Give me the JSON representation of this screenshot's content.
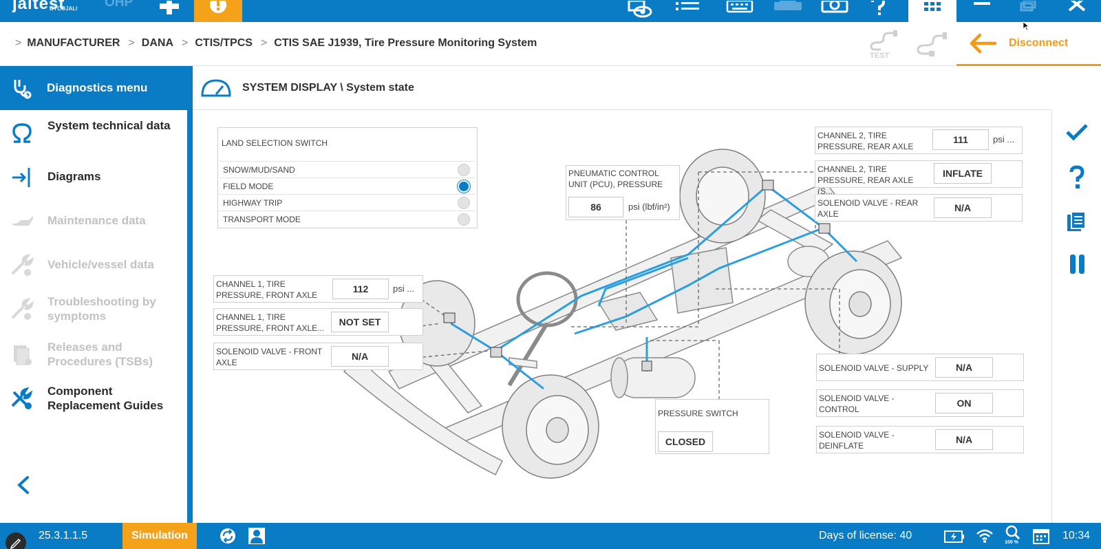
{
  "topbar": {
    "brand": "jaltest",
    "brand_sub": "BYCOJALI",
    "brand_suffix": "OHP",
    "icons": [
      "plus-icon",
      "alert-icon",
      "eye-icon",
      "list-icon",
      "keyboard-icon",
      "printer-icon",
      "camera-icon",
      "help-icon",
      "apps-grid-icon",
      "minimize-icon",
      "restore-icon",
      "close-icon"
    ],
    "accent": "#0a7cc6",
    "alert_color": "#f5a21b"
  },
  "breadcrumb": {
    "items": [
      "MANUFACTURER",
      "DANA",
      "CTIS/TPCS",
      "CTIS SAE J1939, Tire Pressure Monitoring System"
    ],
    "test_label": "TEST",
    "disconnect_label": "Disconnect"
  },
  "sidebar": {
    "header": "Diagnostics menu",
    "items": [
      {
        "label": "System technical data",
        "icon": "omega-icon",
        "enabled": true
      },
      {
        "label": "Diagrams",
        "icon": "diagram-icon",
        "enabled": true
      },
      {
        "label": "Maintenance data",
        "icon": "oil-can-icon",
        "enabled": false
      },
      {
        "label": "Vehicle/vessel data",
        "icon": "wrench-globe-icon",
        "enabled": false
      },
      {
        "label": "Troubleshooting by symptoms",
        "icon": "troubleshoot-icon",
        "enabled": false
      },
      {
        "label": "Releases and Procedures (TSBs)",
        "icon": "document-stack-icon",
        "enabled": false
      },
      {
        "label": "Component Replacement Guides",
        "icon": "tools-globe-icon",
        "enabled": true
      }
    ]
  },
  "main": {
    "title": "SYSTEM DISPLAY \\ System state",
    "land_selection": {
      "title": "LAND SELECTION SWITCH",
      "options": [
        {
          "label": "SNOW/MUD/SAND",
          "selected": false
        },
        {
          "label": "FIELD MODE",
          "selected": true
        },
        {
          "label": "HIGHWAY TRIP",
          "selected": false
        },
        {
          "label": "TRANSPORT MODE",
          "selected": false
        }
      ]
    },
    "pcu": {
      "label": "PNEUMATIC CONTROL UNIT (PCU), PRESSURE",
      "value": "86",
      "unit": "psi (lbf/in²)"
    },
    "ch1_pressure": {
      "label": "CHANNEL 1, TIRE PRESSURE, FRONT AXLE",
      "value": "112",
      "unit": "psi ..."
    },
    "ch1_state": {
      "label": "CHANNEL 1, TIRE PRESSURE, FRONT AXLE...",
      "value": "NOT SET"
    },
    "sol_front": {
      "label": "SOLENOID VALVE - FRONT AXLE",
      "value": "N/A"
    },
    "ch2_pressure": {
      "label": "CHANNEL 2, TIRE PRESSURE, REAR AXLE",
      "value": "111",
      "unit": "psi ..."
    },
    "ch2_state": {
      "label": "CHANNEL 2, TIRE PRESSURE, REAR AXLE (S...",
      "value": "INFLATE"
    },
    "sol_rear": {
      "label": "SOLENOID VALVE - REAR AXLE",
      "value": "N/A"
    },
    "sol_supply": {
      "label": "SOLENOID VALVE - SUPPLY",
      "value": "N/A"
    },
    "sol_control": {
      "label": "SOLENOID VALVE - CONTROL",
      "value": "ON"
    },
    "sol_deinflate": {
      "label": "SOLENOID VALVE - DEINFLATE",
      "value": "N/A"
    },
    "pressure_switch": {
      "label": "PRESSURE SWITCH",
      "value": "CLOSED"
    }
  },
  "right_rail": {
    "icons": [
      "checkmark-icon",
      "help-icon",
      "clipboard-icon",
      "pause-icon"
    ]
  },
  "statusbar": {
    "version": "25.3.1.1.5",
    "mode": "Simulation",
    "license": "Days of license: 40",
    "zoom": "100 %",
    "time": "10:34"
  }
}
